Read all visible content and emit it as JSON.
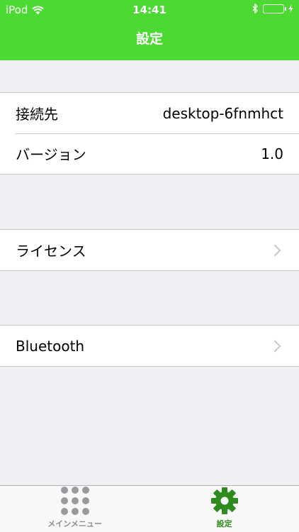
{
  "status_bar": {
    "carrier": "iPod",
    "time": "14:41",
    "icons": [
      "wifi-icon",
      "bluetooth-icon",
      "battery-icon",
      "charging-icon"
    ]
  },
  "nav": {
    "title": "設定"
  },
  "info_group": {
    "rows": [
      {
        "label": "接続先",
        "value": "desktop-6fnmhct"
      },
      {
        "label": "バージョン",
        "value": "1.0"
      }
    ]
  },
  "license_row": {
    "label": "ライセンス",
    "icon": "chevron-right-icon"
  },
  "bluetooth_row": {
    "label": "Bluetooth",
    "icon": "chevron-right-icon"
  },
  "tabbar": {
    "tabs": [
      {
        "label": "メインメニュー",
        "icon": "grid-icon",
        "selected": false
      },
      {
        "label": "設定",
        "icon": "gear-icon",
        "selected": true
      }
    ]
  },
  "colors": {
    "accent": "#4cd932",
    "tab_selected": "#2e8b1e",
    "tab_unselected": "#8e8e93",
    "background": "#efeff4"
  }
}
